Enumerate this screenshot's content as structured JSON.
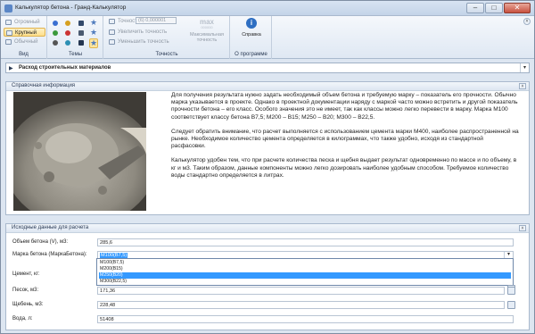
{
  "window": {
    "title": "Калькулятор бетона - Гранд-Калькулятор"
  },
  "ribbon": {
    "view": {
      "label": "Вид",
      "items": [
        "Огромный",
        "Крупный",
        "Обычный"
      ],
      "selected": "Крупный"
    },
    "themes": {
      "label": "Темы"
    },
    "precision": {
      "label": "Точность",
      "title": "Точность",
      "value": "(6) 0,000001",
      "increase": "Увеличить точность",
      "decrease": "Уменьшить точность",
      "max_icon_text": "max",
      "max_icon_sub": "000000",
      "max_label_1": "Максимальная",
      "max_label_2": "точность"
    },
    "about": {
      "label": "О программе",
      "help": "Справка"
    }
  },
  "category": {
    "selected": "Расход строительных материалов"
  },
  "info_panel": {
    "title": "Справочная информация",
    "paragraphs": [
      "Для получения результата нужно задать необходимый объем бетона и требуемую марку – показатель его прочности. Обычно марка указывается в проекте. Однако в проектной документации наряду с маркой часто можно встретить и другой показатель прочности бетона – его класс. Особого значения это не имеет, так как классы можно легко перевести в марку. Марка М100 соответствует классу бетона В7,5; М200 – В15; М250 – В20; М300 – В22,5.",
      "Следует обратить внимание, что расчет выполняется с использованием цемента марки М400, наиболее распространенной на рынке. Необходимое количество цемента определяется в килограммах, что также удобно, исходя из стандартной расфасовки.",
      "Калькулятор удобен тем, что при расчете количества песка и щебня выдает результат одновременно по массе и по объему, в кг и м3. Таким образом, данные компоненты можно легко дозировать наиболее удобным способом. Требуемое количество воды стандартно определяется в литрах."
    ]
  },
  "input_panel": {
    "title": "Исходные данные для расчета",
    "fields": {
      "volume_label": "Объем бетона (V), м3:",
      "volume_value": "285,6",
      "grade_label": "Марка бетона (МаркаБетона):",
      "grade_value": "М100(В7,5)",
      "cement_label": "Цемент, кг:",
      "sand_label": "Песок, м3:",
      "sand_value": "171,36",
      "gravel_label": "Щебень, м3:",
      "gravel_value": "228,48",
      "water_label": "Вода, л:",
      "water_value": "51408"
    },
    "grade_options": [
      "М100(В7,5)",
      "М200(В15)",
      "М250(В20)",
      "М300(В22,5)"
    ],
    "grade_highlighted": "М250(В20)"
  }
}
